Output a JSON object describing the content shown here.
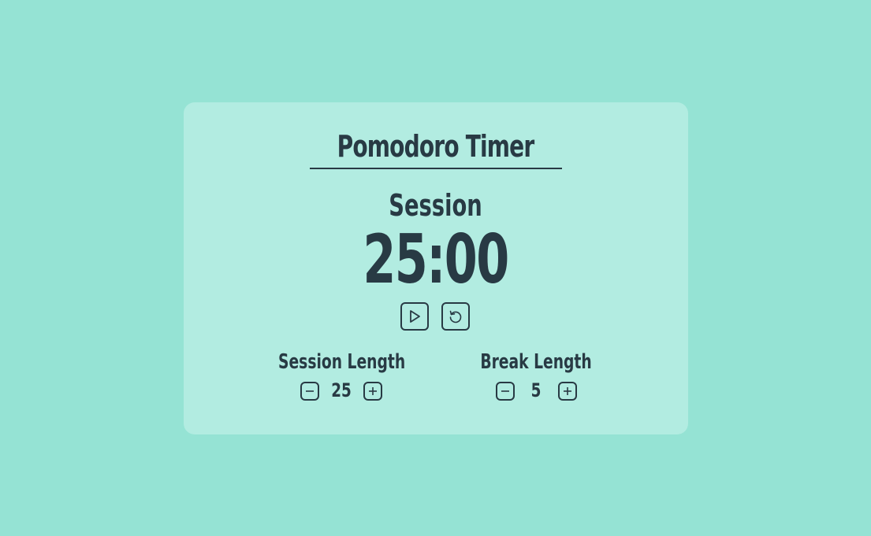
{
  "app": {
    "title": "Pomodoro Timer"
  },
  "timer": {
    "mode": "Session",
    "time": "25:00"
  },
  "controls": {
    "play_icon": "play-icon",
    "reset_icon": "reset-icon"
  },
  "session": {
    "label": "Session Length",
    "value": "25",
    "decrement_icon": "minus-icon",
    "increment_icon": "plus-icon"
  },
  "break": {
    "label": "Break Length",
    "value": "5",
    "decrement_icon": "minus-icon",
    "increment_icon": "plus-icon"
  },
  "colors": {
    "background": "#95e3d4",
    "card": "#b2ece1",
    "ink": "#283a44"
  }
}
